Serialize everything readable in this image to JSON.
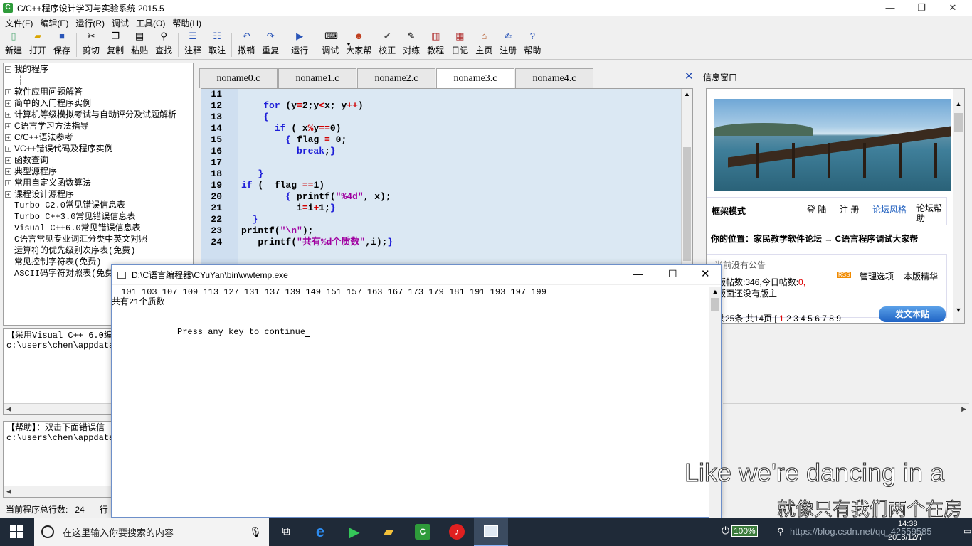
{
  "window": {
    "title": "C/C++程序设计学习与实验系统 2015.5",
    "min": "—",
    "max": "❐",
    "close": "✕"
  },
  "menu": [
    "文件(F)",
    "编辑(E)",
    "运行(R)",
    "调试",
    "工具(O)",
    "帮助(H)"
  ],
  "toolbar": [
    {
      "label": "新建",
      "icon": "new-file-icon"
    },
    {
      "label": "打开",
      "icon": "open-folder-icon"
    },
    {
      "label": "保存",
      "icon": "save-icon"
    },
    {
      "label": "剪切",
      "icon": "scissors-icon"
    },
    {
      "label": "复制",
      "icon": "copy-icon"
    },
    {
      "label": "粘贴",
      "icon": "paste-icon"
    },
    {
      "label": "查找",
      "icon": "binoculars-icon"
    },
    {
      "label": "注释",
      "icon": "comment-icon"
    },
    {
      "label": "取注",
      "icon": "uncomment-icon"
    },
    {
      "label": "撤销",
      "icon": "undo-icon"
    },
    {
      "label": "重复",
      "icon": "redo-icon"
    },
    {
      "label": "运行",
      "icon": "run-icon"
    },
    {
      "label": "调试",
      "icon": "debug-icon"
    },
    {
      "label": "大家帮",
      "icon": "people-icon"
    },
    {
      "label": "校正",
      "icon": "check-icon"
    },
    {
      "label": "对练",
      "icon": "practice-icon"
    },
    {
      "label": "教程",
      "icon": "books-icon"
    },
    {
      "label": "日记",
      "icon": "diary-icon"
    },
    {
      "label": "主页",
      "icon": "home-icon"
    },
    {
      "label": "注册",
      "icon": "register-icon"
    },
    {
      "label": "帮助",
      "icon": "help-icon"
    }
  ],
  "tree": {
    "root": "我的程序",
    "items": [
      "软件应用问题解答",
      "简单的入门程序实例",
      "计算机等级模拟考试与自动评分及试题解析",
      "C语言学习方法指导",
      "C/C++语法参考",
      "VC++错误代码及程序实例",
      "函数查询",
      "典型源程序",
      "常用自定义函数算法",
      "课程设计源程序"
    ],
    "leaves": [
      "Turbo C2.0常见错误信息表",
      "Turbo C++3.0常见错误信息表",
      "Visual C++6.0常见错误信息表",
      "C语言常见专业词汇分类中英文对照",
      "运算符的优先级别次序表(免费)",
      "常见控制字符表(免费)",
      "ASCII码字符对照表(免费)"
    ]
  },
  "output1": [
    "【采用Visual C++ 6.0编",
    "c:\\users\\chen\\appdata"
  ],
  "output2": [
    "【帮助】：双击下面错误信",
    "c:\\users\\chen\\appdata"
  ],
  "status": {
    "lines_label": "当前程序总行数:",
    "lines_value": "24",
    "col_label": "行"
  },
  "tabs": [
    "noname0.c",
    "noname1.c",
    "noname2.c",
    "noname3.c",
    "noname4.c"
  ],
  "active_tab": 3,
  "code": {
    "line_numbers": [
      "11",
      "12",
      "13",
      "14",
      "15",
      "16",
      "17",
      "18",
      "19",
      "20",
      "21",
      "22",
      "23",
      "24"
    ]
  },
  "info": {
    "title": "信息窗口",
    "frame_mode": "框架模式",
    "login": "登 陆",
    "register": "注 册",
    "style": "论坛风格",
    "forum_help": "论坛帮助",
    "location": "你的位置：家民教学软件论坛 → C语言程序调试大家帮",
    "no_notice": "当前没有公告",
    "stats": "版帖数:346,今日帖数:",
    "today": "0,",
    "no_moderator": "版面还没有版主",
    "manage": "管理选项",
    "essence": "本版精华",
    "rss": "RSS",
    "pages": "共25条 共14页 [",
    "page_nums": [
      "1",
      "2",
      "3",
      "4",
      "5",
      "6",
      "7",
      "8",
      "9"
    ],
    "post_btn": "发文本贴"
  },
  "console": {
    "title": "D:\\C语言编程器\\CYuYan\\bin\\wwtemp.exe",
    "line1": " 101 103 107 109 113 127 131 137 139 149 151 157 163 167 173 179 181 191 193 197 199",
    "line2": "共有21个质数",
    "line3": "Press any key to continue"
  },
  "taskbar": {
    "search": "在这里输入你要搜索的内容",
    "battery": "100%",
    "time": "14:38",
    "date": "2018/12/7",
    "watermark": "https://blog.csdn.net/qq_42559585"
  },
  "subtitle": {
    "en": "Like we're dancing in a",
    "zh": "就像只有我们两个在房"
  }
}
